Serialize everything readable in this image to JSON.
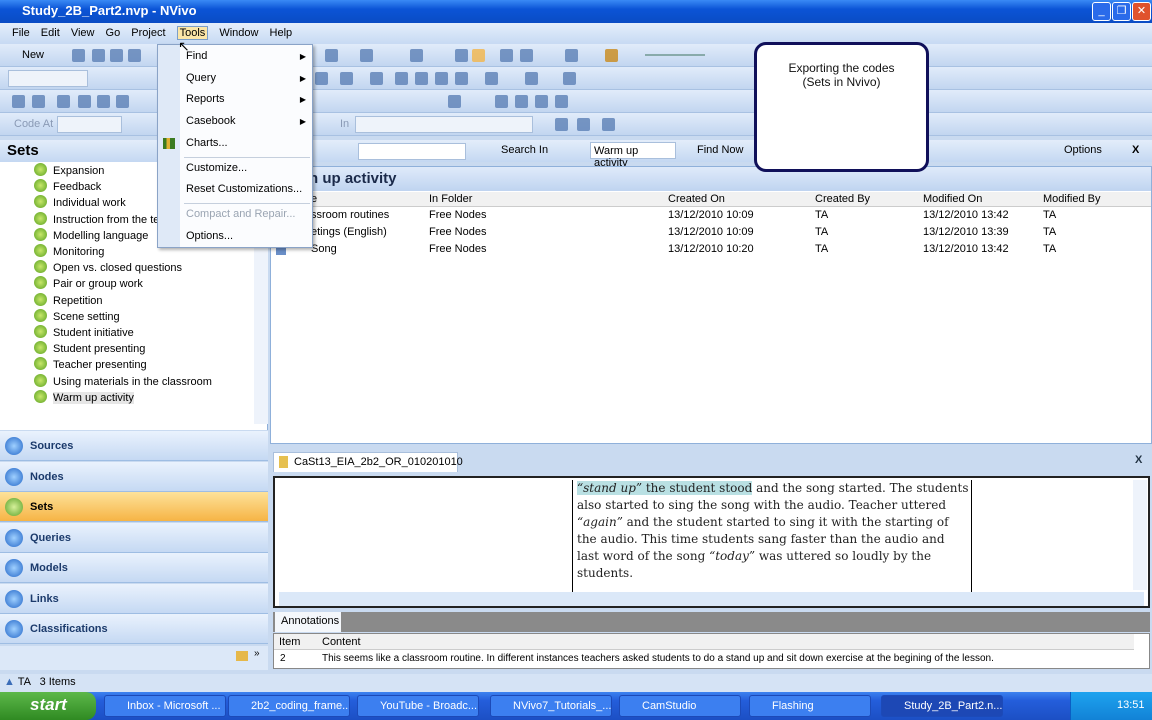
{
  "window": {
    "title": "Study_2B_Part2.nvp - NVivo",
    "controls": [
      "_",
      "❐",
      "✕"
    ]
  },
  "menubar": [
    "File",
    "Edit",
    "View",
    "Go",
    "Project",
    "Tools",
    "Window",
    "Help"
  ],
  "toolbar": {
    "new_label": "New",
    "code_at_label": "Code At",
    "in_label": "In"
  },
  "tools_menu": {
    "items": [
      {
        "label": "Find",
        "submenu": true
      },
      {
        "label": "Query",
        "submenu": true
      },
      {
        "label": "Reports",
        "submenu": true
      },
      {
        "label": "Casebook",
        "submenu": true
      },
      {
        "label": "Charts...",
        "submenu": false
      },
      {
        "label": "Customize...",
        "submenu": false
      },
      {
        "label": "Reset Customizations...",
        "submenu": false
      },
      {
        "label": "Compact and Repair...",
        "submenu": false,
        "disabled": true
      },
      {
        "label": "Options...",
        "submenu": false
      }
    ]
  },
  "sidebar": {
    "title": "Sets",
    "items": [
      "Expansion",
      "Feedback",
      "Individual work",
      "Instruction from the tea",
      "Modelling language",
      "Monitoring",
      "Open vs. closed questions",
      "Pair or group work",
      "Repetition",
      "Scene setting",
      "Student initiative",
      "Student presenting",
      "Teacher presenting",
      "Using materials in the classroom",
      "Warm up activity"
    ],
    "selected": "Warm up activity"
  },
  "nav": [
    "Sources",
    "Nodes",
    "Sets",
    "Queries",
    "Models",
    "Links",
    "Classifications"
  ],
  "nav_selected": "Sets",
  "findbar": {
    "search_in_label": "Search In",
    "search_value": "Warm up activity",
    "find_now": "Find Now",
    "options": "Options",
    "close": "X"
  },
  "list": {
    "title": "n up activity",
    "columns": [
      "e",
      "In Folder",
      "Created On",
      "Created By",
      "Modified On",
      "Modified By"
    ],
    "rows": [
      [
        "ssroom routines",
        "Free Nodes",
        "13/12/2010 10:09",
        "TA",
        "13/12/2010 13:42",
        "TA"
      ],
      [
        "etings (English)",
        "Free Nodes",
        "13/12/2010 10:09",
        "TA",
        "13/12/2010 13:39",
        "TA"
      ],
      [
        "Song",
        "Free Nodes",
        "13/12/2010 10:20",
        "TA",
        "13/12/2010 13:42",
        "TA"
      ]
    ]
  },
  "document": {
    "tab": "CaSt13_EIA_2b2_OR_010201010",
    "close": "X",
    "lines": [
      {
        "italic": "“stand up”",
        "bold": " the student stood",
        "rest": " and the song started. The students"
      },
      {
        "text": "also started to sing the song with the audio.  Teacher uttered"
      },
      {
        "italic": "“again”",
        "rest": " and the student started to sing it with the starting of"
      },
      {
        "text": "the audio.  This time students sang faster than the audio and"
      },
      {
        "pre": "last word of the song ",
        "italic": "“today”",
        "rest": "  was uttered so loudly by the"
      },
      {
        "text": "students."
      }
    ]
  },
  "annotations": {
    "tab": "Annotations",
    "columns": [
      "Item",
      "Content"
    ],
    "rows": [
      [
        "2",
        "This seems like a classroom routine. In different instances teachers asked students to do a stand up and sit down exercise at the begining of the lesson."
      ]
    ]
  },
  "status": {
    "user": "TA",
    "items": "3 Items"
  },
  "callout": {
    "line1": "Exporting the codes",
    "line2": "(Sets in Nvivo)"
  },
  "taskbar": {
    "start": "start",
    "tasks": [
      "Inbox - Microsoft ...",
      "2b2_coding_frame...",
      "YouTube - Broadc...",
      "NVivo7_Tutorials_...",
      "CamStudio",
      "Flashing",
      "Study_2B_Part2.n..."
    ],
    "active": "Study_2B_Part2.n...",
    "clock": "13:51"
  }
}
